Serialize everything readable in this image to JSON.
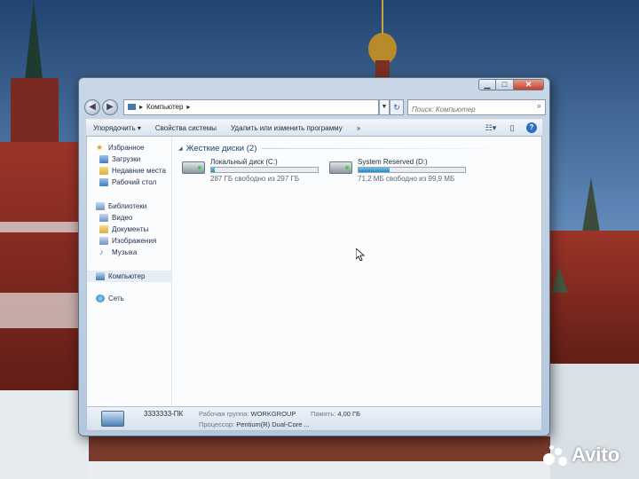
{
  "window": {
    "caption_min": "▁",
    "caption_max": "□",
    "caption_close": "✕"
  },
  "address": {
    "back": "◀",
    "forward": "▶",
    "path": "Компьютер",
    "dropdown": "▼",
    "refresh": "↻",
    "search_placeholder": "Поиск: Компьютер"
  },
  "toolbar": {
    "organize": "Упорядочить ▾",
    "system_properties": "Свойства системы",
    "uninstall": "Удалить или изменить программу",
    "more": "»",
    "help": "?"
  },
  "navpane": {
    "favorites": "Избранное",
    "downloads": "Загрузки",
    "recent": "Недавние места",
    "desktop": "Рабочий стол",
    "libraries": "Библиотеки",
    "video": "Видео",
    "documents": "Документы",
    "images": "Изображения",
    "music": "Музыка",
    "computer": "Компьютер",
    "network": "Сеть"
  },
  "main": {
    "group_title": "Жесткие диски (2)",
    "drives": [
      {
        "name": "Локальный диск (C:)",
        "free": "287 ГБ свободно из 297 ГБ",
        "used_fraction": 0.034
      },
      {
        "name": "System Reserved (D:)",
        "free": "71,2 МБ свободно из 99,9 МБ",
        "used_fraction": 0.29
      }
    ]
  },
  "details": {
    "pc_name": "3333333-ПК",
    "workgroup_label": "Рабочая группа:",
    "workgroup": "WORKGROUP",
    "memory_label": "Память:",
    "memory": "4,00 ГБ",
    "cpu_label": "Процессор:",
    "cpu": "Pentium(R) Dual-Core ..."
  },
  "watermark": {
    "text": "Avito"
  },
  "colors": {
    "accent": "#1e8bc3",
    "title_text": "#1e3f73"
  }
}
